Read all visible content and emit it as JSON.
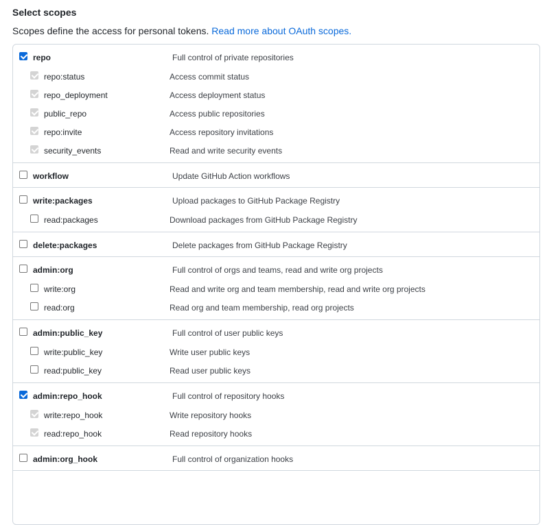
{
  "header": {
    "title": "Select scopes",
    "description_text": "Scopes define the access for personal tokens. ",
    "link_text": "Read more about OAuth scopes."
  },
  "scopes": [
    {
      "name": "repo",
      "description": "Full control of private repositories",
      "checked": true,
      "children": [
        {
          "name": "repo:status",
          "description": "Access commit status",
          "state": "inherited"
        },
        {
          "name": "repo_deployment",
          "description": "Access deployment status",
          "state": "inherited"
        },
        {
          "name": "public_repo",
          "description": "Access public repositories",
          "state": "inherited"
        },
        {
          "name": "repo:invite",
          "description": "Access repository invitations",
          "state": "inherited"
        },
        {
          "name": "security_events",
          "description": "Read and write security events",
          "state": "inherited"
        }
      ]
    },
    {
      "name": "workflow",
      "description": "Update GitHub Action workflows",
      "checked": false,
      "children": []
    },
    {
      "name": "write:packages",
      "description": "Upload packages to GitHub Package Registry",
      "checked": false,
      "children": [
        {
          "name": "read:packages",
          "description": "Download packages from GitHub Package Registry",
          "state": "unchecked"
        }
      ]
    },
    {
      "name": "delete:packages",
      "description": "Delete packages from GitHub Package Registry",
      "checked": false,
      "children": []
    },
    {
      "name": "admin:org",
      "description": "Full control of orgs and teams, read and write org projects",
      "checked": false,
      "children": [
        {
          "name": "write:org",
          "description": "Read and write org and team membership, read and write org projects",
          "state": "unchecked"
        },
        {
          "name": "read:org",
          "description": "Read org and team membership, read org projects",
          "state": "unchecked"
        }
      ]
    },
    {
      "name": "admin:public_key",
      "description": "Full control of user public keys",
      "checked": false,
      "children": [
        {
          "name": "write:public_key",
          "description": "Write user public keys",
          "state": "unchecked"
        },
        {
          "name": "read:public_key",
          "description": "Read user public keys",
          "state": "unchecked"
        }
      ]
    },
    {
      "name": "admin:repo_hook",
      "description": "Full control of repository hooks",
      "checked": true,
      "children": [
        {
          "name": "write:repo_hook",
          "description": "Write repository hooks",
          "state": "inherited"
        },
        {
          "name": "read:repo_hook",
          "description": "Read repository hooks",
          "state": "inherited"
        }
      ]
    },
    {
      "name": "admin:org_hook",
      "description": "Full control of organization hooks",
      "checked": false,
      "children": []
    }
  ]
}
